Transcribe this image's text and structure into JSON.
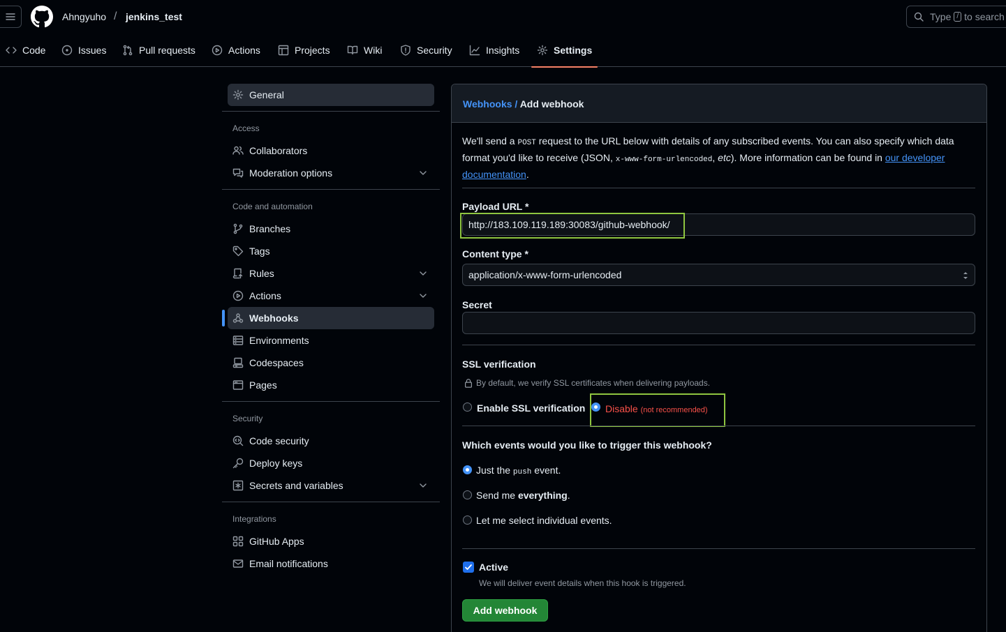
{
  "header": {
    "owner": "Ahngyuho",
    "separator": "/",
    "repo": "jenkins_test",
    "search_prefix": "Type",
    "search_key": "/",
    "search_suffix": "to search"
  },
  "repo_nav": [
    {
      "label": "Code",
      "icon": "code-icon"
    },
    {
      "label": "Issues",
      "icon": "issue-icon"
    },
    {
      "label": "Pull requests",
      "icon": "pull-request-icon"
    },
    {
      "label": "Actions",
      "icon": "play-icon"
    },
    {
      "label": "Projects",
      "icon": "table-icon"
    },
    {
      "label": "Wiki",
      "icon": "book-icon"
    },
    {
      "label": "Security",
      "icon": "shield-icon"
    },
    {
      "label": "Insights",
      "icon": "graph-icon"
    },
    {
      "label": "Settings",
      "icon": "gear-icon",
      "active": true
    }
  ],
  "sidebar": {
    "general": "General",
    "sections": [
      {
        "heading": "Access",
        "items": [
          "Collaborators",
          "Moderation options"
        ]
      },
      {
        "heading": "Code and automation",
        "items": [
          "Branches",
          "Tags",
          "Rules",
          "Actions",
          "Webhooks",
          "Environments",
          "Codespaces",
          "Pages"
        ]
      },
      {
        "heading": "Security",
        "items": [
          "Code security",
          "Deploy keys",
          "Secrets and variables"
        ]
      },
      {
        "heading": "Integrations",
        "items": [
          "GitHub Apps",
          "Email notifications"
        ]
      }
    ],
    "current": "Webhooks"
  },
  "breadcrumb": {
    "parent": "Webhooks",
    "separator": "/",
    "current": "Add webhook"
  },
  "intro": {
    "t1": "We'll send a ",
    "c1": "POST",
    "t2": " request to the URL below with details of any subscribed events. You can also specify which data format you'd like to receive (JSON, ",
    "c2": "x-www-form-urlencoded",
    "t3": ", ",
    "t3i": "etc",
    "t4": "). More information can be found in ",
    "link": "our developer documentation",
    "t5": "."
  },
  "form": {
    "payload_label": "Payload URL *",
    "payload_value": "http://183.109.119.189:30083/github-webhook/",
    "content_type_label": "Content type *",
    "content_type_value": "application/x-www-form-urlencoded",
    "secret_label": "Secret",
    "secret_value": "",
    "ssl_label": "SSL verification",
    "ssl_note": "By default, we verify SSL certificates when delivering payloads.",
    "ssl_enable": "Enable SSL verification",
    "ssl_disable": "Disable",
    "ssl_disable_note": "(not recommended)",
    "ssl_selected": "disable",
    "events_question": "Which events would you like to trigger this webhook?",
    "event_push_1": "Just the ",
    "event_push_code": "push",
    "event_push_2": " event.",
    "event_all_1": "Send me ",
    "event_all_bold": "everything",
    "event_all_2": ".",
    "event_select": "Let me select individual events.",
    "events_selected": "push",
    "active_label": "Active",
    "active_checked": true,
    "active_note": "We will deliver event details when this hook is triggered.",
    "submit": "Add webhook"
  },
  "colors": {
    "accent": "#4493f8",
    "highlight_box": "#8fc540",
    "danger": "#f85149",
    "primary_button": "#238636",
    "selected_tab": "#f78166"
  }
}
